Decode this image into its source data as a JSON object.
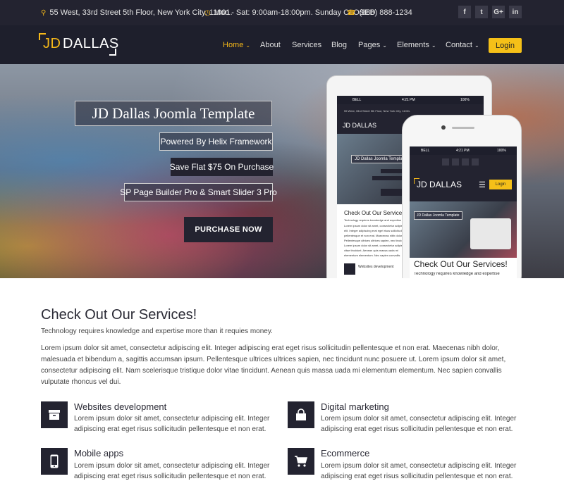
{
  "topbar": {
    "address": "55 West, 33rd Street 5th Floor, New York City, 11001.",
    "hours": "Mon - Sat: 9:00am-18:00pm. Sunday CLOSED",
    "phone": "(888) 888-1234",
    "social": [
      {
        "icon": "facebook-icon",
        "glyph": "f"
      },
      {
        "icon": "twitter-icon",
        "glyph": "t"
      },
      {
        "icon": "google-plus-icon",
        "glyph": "G+"
      },
      {
        "icon": "linkedin-icon",
        "glyph": "in"
      }
    ]
  },
  "header": {
    "logo_jd": "JD",
    "logo_name": "DALLAS",
    "nav": {
      "home": "Home",
      "about": "About",
      "services": "Services",
      "blog": "Blog",
      "pages": "Pages",
      "elements": "Elements",
      "contact": "Contact"
    },
    "login_label": "Login"
  },
  "hero": {
    "title": "JD Dallas Joomla Template",
    "tag1": "Powered By Helix Framework",
    "tag2": "Save Flat $75 On Purchase",
    "tag3": "SP Page Builder Pro & Smart Slider 3 Pro",
    "purchase_label": "PURCHASE NOW"
  },
  "tablet": {
    "carrier": "BELL",
    "time": "4:21 PM",
    "battery": "100%",
    "address": "55 West, 33rd Street 5th Floor, New York City, 11001.",
    "logo": "JD DALLAS",
    "hero_title": "JD Dallas Joomla Template",
    "section_title": "Check Out Our Services!",
    "section_sub": "Technology requires knowledge and expertise",
    "lines": [
      "Lorem ipsum dolor sit amet, consectetur adipiscing",
      "elit. Integer adipiscing erat eget risus sollicitudin",
      "pellentesque et non erat. Maecenas nibh dolor,",
      "Pellentesque ultrices ultrices sapien, nec tincidunt",
      "Lorem ipsum dolor sit amet, consectetur adipiscing",
      "vitae tincidunt. Aenean quis massa uada mi",
      "elementum elementum. Nec sapien convallis"
    ],
    "service": "Websites development"
  },
  "phone": {
    "carrier": "BELL",
    "time": "4:21 PM",
    "battery": "100%",
    "logo": "JD DALLAS",
    "login": "Login",
    "hero_title": "JD Dallas Joomla Template",
    "section_title": "Check Out Our Services!",
    "section_sub": "Technology requires knowledge and expertise"
  },
  "services": {
    "title": "Check Out Our Services!",
    "subtitle": "Technology requires knowledge and expertise more than it requies money.",
    "body": "Lorem ipsum dolor sit amet, consectetur adipiscing elit. Integer adipiscing erat eget risus sollicitudin pellentesque et non erat. Maecenas nibh dolor, malesuada et bibendum a, sagittis accumsan ipsum. Pellentesque ultrices ultrices sapien, nec tincidunt nunc posuere ut. Lorem ipsum dolor sit amet, consectetur adipiscing elit. Nam scelerisque tristique dolor vitae tincidunt. Aenean quis massa uada mi elementum elementum. Nec sapien convallis vulputate rhoncus vel dui.",
    "items": [
      {
        "title": "Websites development",
        "icon": "box-icon",
        "desc": "Lorem ipsum dolor sit amet, consectetur adipiscing elit. Integer adipiscing erat eget risus sollicitudin pellentesque et non erat."
      },
      {
        "title": "Digital marketing",
        "icon": "shopping-bag-icon",
        "desc": "Lorem ipsum dolor sit amet, consectetur adipiscing elit. Integer adipiscing erat eget risus sollicitudin pellentesque et non erat."
      },
      {
        "title": "Mobile apps",
        "icon": "mobile-phone-icon",
        "desc": "Lorem ipsum dolor sit amet, consectetur adipiscing elit. Integer adipiscing erat eget risus sollicitudin pellentesque et non erat."
      },
      {
        "title": "Ecommerce",
        "icon": "shopping-cart-icon",
        "desc": "Lorem ipsum dolor sit amet, consectetur adipiscing elit. Integer adipiscing erat eget risus sollicitudin pellentesque et non erat."
      }
    ]
  },
  "colors": {
    "accent": "#f5b819",
    "dark": "#232330",
    "header": "#1e1f2c"
  }
}
